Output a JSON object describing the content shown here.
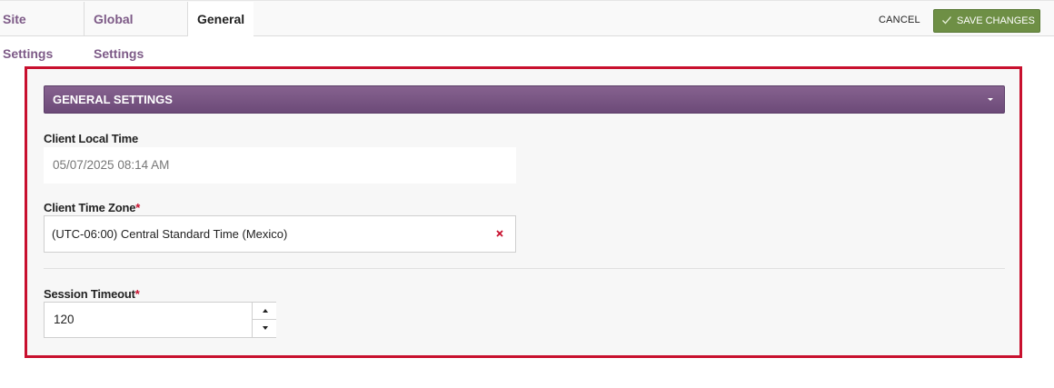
{
  "breadcrumb": {
    "items": [
      "Site Settings",
      "Global Settings",
      "General"
    ]
  },
  "toolbar": {
    "cancel_label": "CANCEL",
    "save_label": "SAVE CHANGES",
    "save_icon": "check-icon"
  },
  "section": {
    "title": "GENERAL SETTINGS",
    "toggle_icon": "caret-down-icon"
  },
  "fields": {
    "client_local_time": {
      "label": "Client Local Time",
      "value": "05/07/2025 08:14 AM"
    },
    "client_time_zone": {
      "label": "Client Time Zone",
      "required_mark": "*",
      "value": "(UTC-06:00) Central Standard Time (Mexico)",
      "clear_icon": "close-icon"
    },
    "session_timeout": {
      "label": "Session Timeout",
      "required_mark": "*",
      "value": "120"
    }
  },
  "colors": {
    "accent_purple": "#7d5a87",
    "save_green": "#6e8f45",
    "highlight_red": "#c8102e"
  }
}
